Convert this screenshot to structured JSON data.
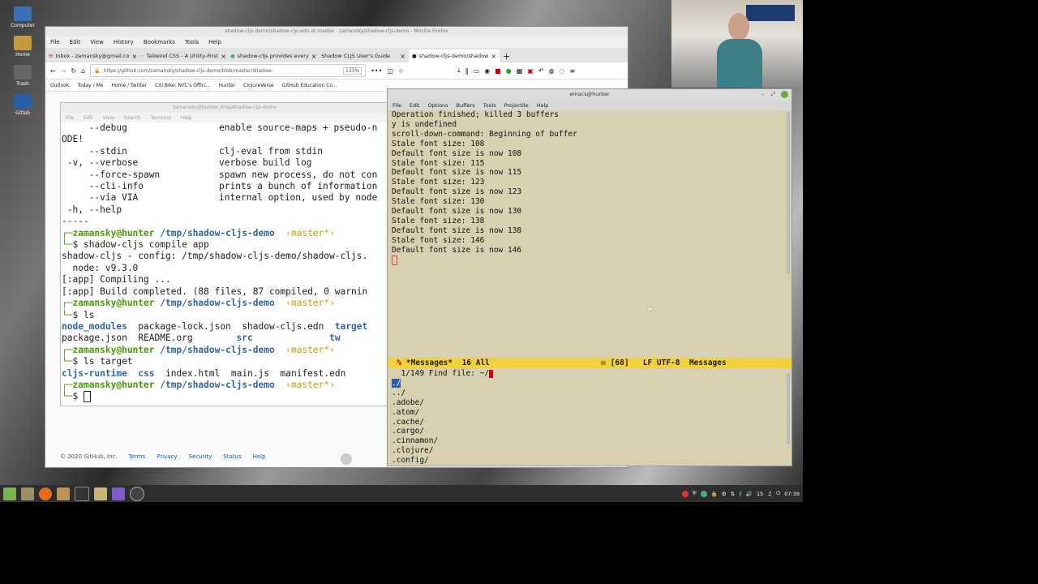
{
  "desktop": {
    "icons": [
      {
        "label": "Computer"
      },
      {
        "label": "Home"
      },
      {
        "label": "Trash"
      },
      {
        "label": "Gitlab"
      }
    ]
  },
  "firefox": {
    "title": "shadow-cljs-demo/shadow-cljs.edn at master · zamansky/shadow-cljs-demo - Mozilla Firefox",
    "menu": [
      "File",
      "Edit",
      "View",
      "History",
      "Bookmarks",
      "Tools",
      "Help"
    ],
    "tabs": [
      {
        "label": "Inbox - zamansky@gmail.co"
      },
      {
        "label": "Tailwind CSS - A Utility-First"
      },
      {
        "label": "shadow-cljs provides every"
      },
      {
        "label": "Shadow CLJS User's Guide"
      },
      {
        "label": "shadow-cljs-demo/shadow"
      }
    ],
    "url": "https://github.com/zamansky/shadow-cljs-demo/blob/master/shadow-",
    "zoom": "133%",
    "bookmarks": [
      "Outlook",
      "Today / Me",
      "Home / Twitter",
      "Citi Bike: NYC's Offici...",
      "Hunter",
      "ClojureVerse",
      "GitHub Education Co..."
    ],
    "footer": {
      "copyright": "© 2020 GitHub, Inc.",
      "links": [
        "Terms",
        "Privacy",
        "Security",
        "Status",
        "Help"
      ]
    }
  },
  "terminal": {
    "title": "zamansky@hunter /tmp/shadow-cljs-demo",
    "menu": [
      "File",
      "Edit",
      "View",
      "Search",
      "Terminal",
      "Help"
    ],
    "lines": {
      "l1a": "     --debug",
      "l1b": "enable source-maps + pseudo-n",
      "l2": "ODE!",
      "l3a": "     --stdin",
      "l3b": "clj-eval from stdin",
      "l4a": " -v, --verbose",
      "l4b": "verbose build log",
      "l5a": "     --force-spawn",
      "l5b": "spawn new process, do not con",
      "l6a": "     --cli-info",
      "l6b": "prints a bunch of information",
      "l7a": "     --via VIA",
      "l7b": "internal option, used by node",
      "l8a": " -h, --help",
      "l9": "-----",
      "prompt_user": "zamansky@hunter",
      "prompt_path": "/tmp/shadow-cljs-demo",
      "prompt_branch": "‹master*›",
      "cmd1": "shadow-cljs compile app",
      "out1": "shadow-cljs - config: /tmp/shadow-cljs-demo/shadow-cljs.",
      "out2": "  node: v9.3.0",
      "out3": "[:app] Compiling ...",
      "out4": "[:app] Build completed. (88 files, 87 compiled, 0 warnin",
      "cmd2": "ls",
      "ls1": [
        "node_modules",
        "package-lock.json",
        "shadow-cljs.edn",
        "target"
      ],
      "ls2": [
        "package.json",
        "README.org",
        "src",
        "tw"
      ],
      "cmd3": "ls target",
      "ls3": [
        "cljs-runtime",
        "css",
        "index.html",
        "main.js",
        "manifest.edn"
      ],
      "prompt_glyph": "$"
    }
  },
  "emacs": {
    "title": "emacs@hunter",
    "menu": [
      "File",
      "Edit",
      "Options",
      "Buffers",
      "Tools",
      "Projectile",
      "Help"
    ],
    "messages": [
      "Operation finished; killed 3 buffers",
      "y is undefined",
      "scroll-down-command: Beginning of buffer",
      "Stale font size: 108",
      "Default font size is now 108",
      "Stale font size: 115",
      "Default font size is now 115",
      "Stale font size: 123",
      "Default font size is now 123",
      "Stale font size: 130",
      "Default font size is now 130",
      "Stale font size: 138",
      "Default font size is now 138",
      "Stale font size: 146",
      "Default font size is now 146"
    ],
    "modeline": {
      "buffer": "*Messages*",
      "position": "16 All",
      "lines": "[68]",
      "encoding": "LF UTF-8",
      "mode": "Messages"
    },
    "minibuffer": {
      "prompt": "1/149 Find file: ~/",
      "candidates": [
        "./",
        "../",
        ".adobe/",
        ".atom/",
        ".cache/",
        ".cargo/",
        ".cinnamon/",
        ".clojure/",
        ".config/"
      ]
    }
  },
  "taskbar": {
    "clock": "07:39",
    "volume": "15"
  },
  "colors": {
    "modeline": "#f2d13a",
    "emacs_bg": "#d8d0b0",
    "prompt_green": "#4e9a06",
    "path_blue": "#3465a4"
  }
}
